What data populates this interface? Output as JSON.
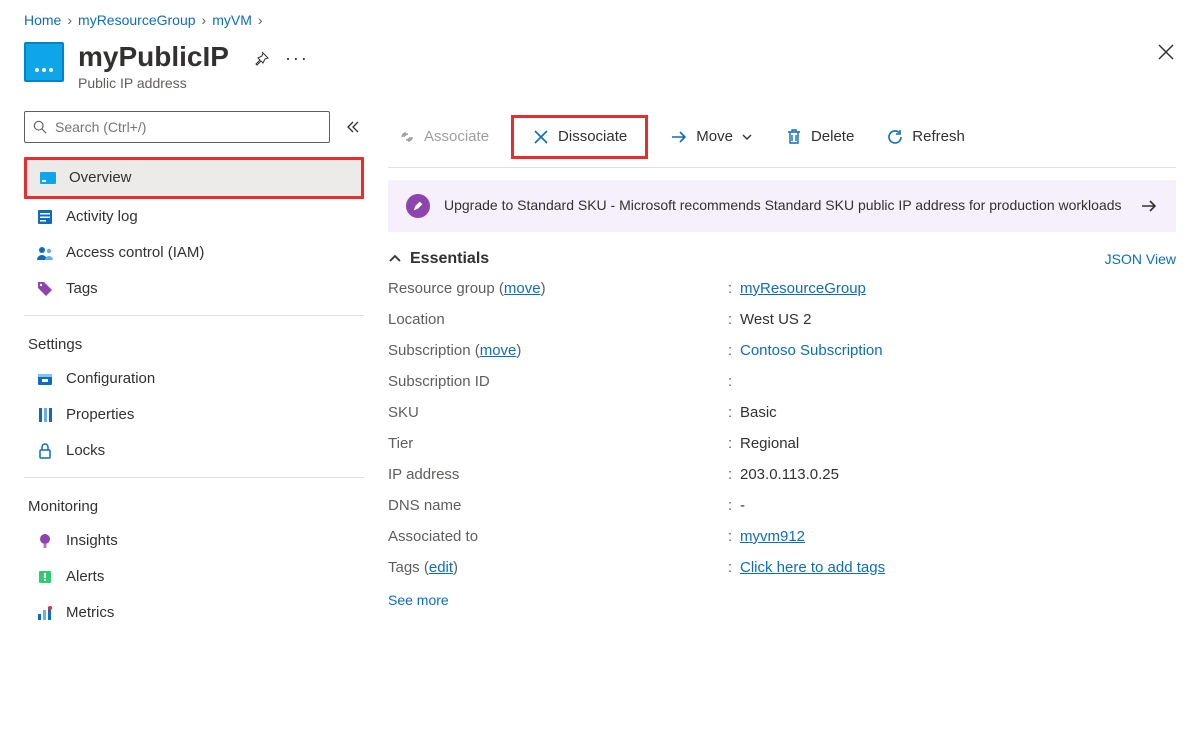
{
  "breadcrumb": [
    {
      "label": "Home"
    },
    {
      "label": "myResourceGroup"
    },
    {
      "label": "myVM"
    }
  ],
  "header": {
    "title": "myPublicIP",
    "subtitle": "Public IP address"
  },
  "search": {
    "placeholder": "Search (Ctrl+/)"
  },
  "nav": {
    "items": [
      {
        "label": "Overview",
        "active": true
      },
      {
        "label": "Activity log"
      },
      {
        "label": "Access control (IAM)"
      },
      {
        "label": "Tags"
      }
    ],
    "settings_title": "Settings",
    "settings": [
      {
        "label": "Configuration"
      },
      {
        "label": "Properties"
      },
      {
        "label": "Locks"
      }
    ],
    "monitoring_title": "Monitoring",
    "monitoring": [
      {
        "label": "Insights"
      },
      {
        "label": "Alerts"
      },
      {
        "label": "Metrics"
      }
    ]
  },
  "toolbar": {
    "associate": "Associate",
    "dissociate": "Dissociate",
    "move": "Move",
    "delete": "Delete",
    "refresh": "Refresh"
  },
  "banner": {
    "text": "Upgrade to Standard SKU - Microsoft recommends Standard SKU public IP address for production workloads"
  },
  "essentials": {
    "title": "Essentials",
    "json_view": "JSON View",
    "rows": {
      "resource_group_label": "Resource group",
      "resource_group_move": "move",
      "resource_group_value": "myResourceGroup",
      "location_label": "Location",
      "location_value": "West US 2",
      "subscription_label": "Subscription",
      "subscription_move": "move",
      "subscription_value": "Contoso Subscription",
      "subscription_id_label": "Subscription ID",
      "subscription_id_value": "",
      "sku_label": "SKU",
      "sku_value": "Basic",
      "tier_label": "Tier",
      "tier_value": "Regional",
      "ip_label": "IP address",
      "ip_value": "203.0.113.0.25",
      "dns_label": "DNS name",
      "dns_value": "-",
      "assoc_label": "Associated to",
      "assoc_value": "myvm912",
      "tags_label": "Tags",
      "tags_edit": "edit",
      "tags_value": "Click here to add tags"
    },
    "see_more": "See more"
  }
}
